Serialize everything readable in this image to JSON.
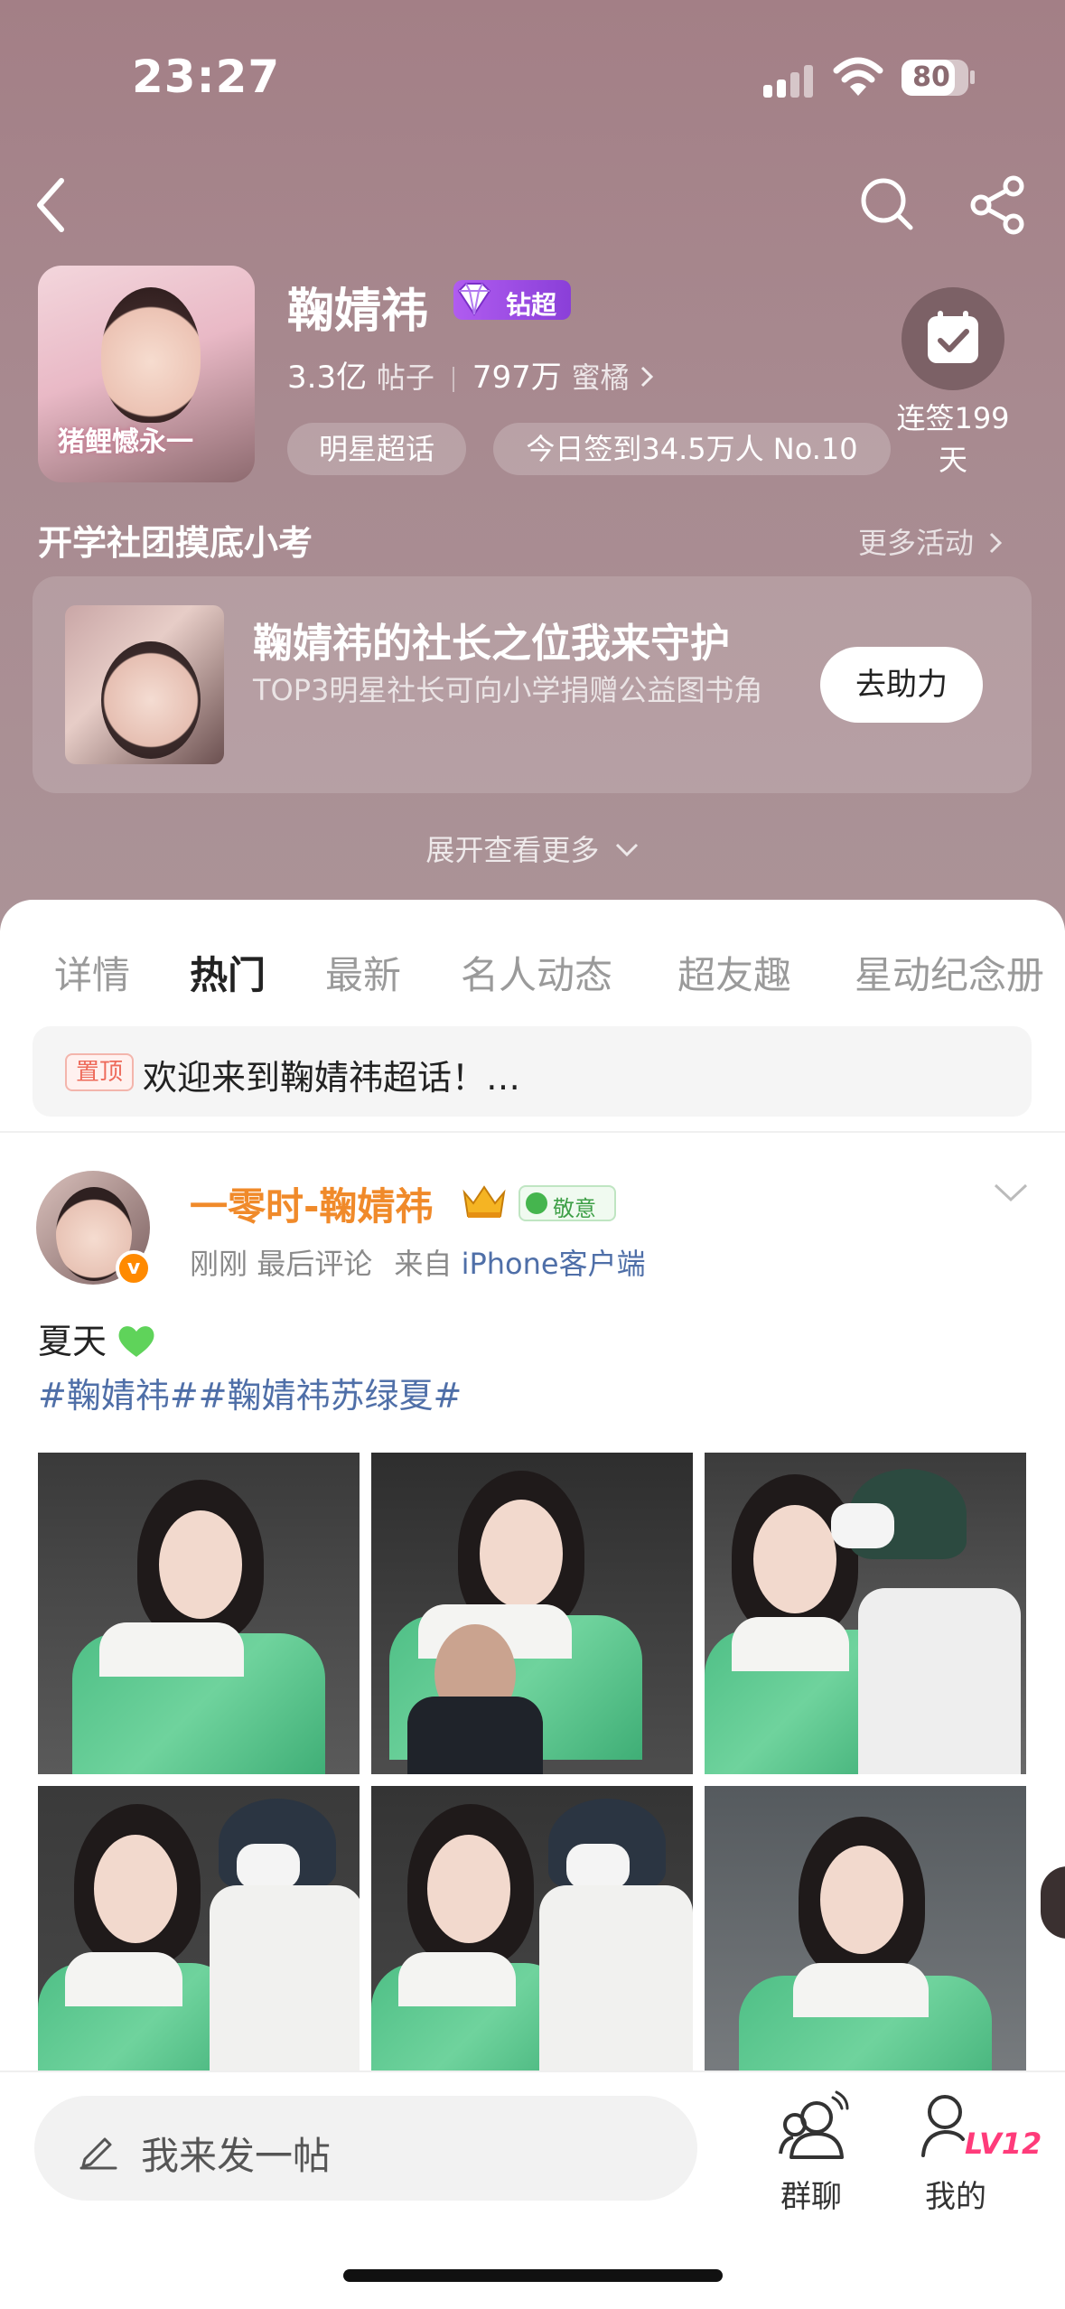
{
  "status_bar": {
    "time": "23:27",
    "battery": "80",
    "battery_level": 0.8
  },
  "topic": {
    "name": "鞠婧祎",
    "badge": "钻超",
    "cover_text": "猪鲤憾永一",
    "posts_value": "3.3亿",
    "posts_label": "帖子",
    "fans_value": "797万",
    "fans_label": "蜜橘",
    "category_pill": "明星超话",
    "checkin_pill": "今日签到34.5万人 No.10",
    "streak_label": "连签199天"
  },
  "activity": {
    "section_title": "开学社团摸底小考",
    "more_label": "更多活动",
    "card_title": "鞠婧祎的社长之位我来守护",
    "card_subtitle": "TOP3明星社长可向小学捐赠公益图书角",
    "card_button": "去助力",
    "expand_label": "展开查看更多"
  },
  "tabs": [
    "详情",
    "热门",
    "最新",
    "名人动态",
    "超友趣",
    "星动纪念册"
  ],
  "active_tab": "热门",
  "pinned": {
    "tag": "置顶",
    "text": "欢迎来到鞠婧祎超话！…"
  },
  "post": {
    "author": "一零时-鞠婧祎",
    "respect_badge": "敬意",
    "time": "刚刚",
    "last_comment": "最后评论",
    "source_prefix": "来自",
    "source": "iPhone客户端",
    "text": "夏天",
    "hashtags": "#鞠婧祎##鞠婧祎苏绿夏#"
  },
  "bottom_bar": {
    "compose_placeholder": "我来发一帖",
    "group_chat": "群聊",
    "mine": "我的",
    "level": "LV12"
  },
  "colors": {
    "hero_bg": "#a6858b",
    "accent_orange": "#ff7a1a",
    "link_blue": "#4f6fa8",
    "diamond_purple": "#9a4be6",
    "level_pink": "#ff3b7a"
  }
}
